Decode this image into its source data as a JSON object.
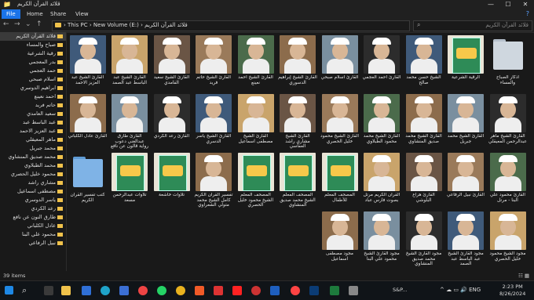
{
  "window": {
    "title": "قلائد القرآن الكريم",
    "controls": [
      "—",
      "☐",
      "✕"
    ]
  },
  "ribbon": {
    "tabs": [
      "File",
      "Home",
      "Share",
      "View"
    ],
    "help": "?"
  },
  "address": {
    "crumbs": "›  This PC  ›  New Volume (E:)  ›  قلائد القرآن الكريم",
    "search_placeholder": "قلائد القرآن الكريم"
  },
  "sidebar": {
    "items": [
      "قلائد القرآن الكريم",
      "صباح والمساء",
      "رقية الشرعية",
      "بدر المعجمي",
      "حمد العجمي",
      "اسلام صبحي",
      "ابراهيم الدوسري",
      "احمد نعينع",
      "حاتم فريد",
      "سعيد العامدي",
      "عبد الباسط عبد",
      "عبد العزيز الاحمد",
      "ماهر المعيقلي",
      "محمد جبريل",
      "محمد صديق المنشاوي",
      "محمد الطبلاوي",
      "محمود خليل الحصري",
      "مشاري راشد",
      "مصطفى اسماعيل",
      "ياسر الدوسري",
      "رعد الكردي",
      "طارق النون عن نافع",
      "عادل الكلباني",
      "محمود علي البنا",
      "نبيل الرفاعي"
    ]
  },
  "files": [
    {
      "label": "اذكار الصباح والمساء",
      "kind": "folder"
    },
    {
      "label": "الرقية الشرعية",
      "kind": "book"
    },
    {
      "label": "الشيخ حسن محمد صالح",
      "kind": "person"
    },
    {
      "label": "القارئ أحمد العجمي",
      "kind": "person"
    },
    {
      "label": "القارئ اسلام صبحي",
      "kind": "person"
    },
    {
      "label": "القارئ الشيخ إبراهيم الدسوري",
      "kind": "person"
    },
    {
      "label": "القارئ الشيخ أحمد نعينع",
      "kind": "person"
    },
    {
      "label": "القارئ الشيخ حاتم فريد",
      "kind": "person"
    },
    {
      "label": "القارئ الشيخ سعيد القامدي",
      "kind": "person"
    },
    {
      "label": "القارئ الشيخ عبد الباسط عبد الصمد",
      "kind": "person"
    },
    {
      "label": "القارئ الشيخ عبد العزيز الاحمد",
      "kind": "person"
    },
    {
      "label": "القارئ الشيخ ماهر عبدالرحمن المعيقلي",
      "kind": "person"
    },
    {
      "label": "القارئ الشيخ محمد جبريل",
      "kind": "person"
    },
    {
      "label": "القارئ الشيخ محمد صديق المنشاوي",
      "kind": "person"
    },
    {
      "label": "القارئ الشيخ محمد محمود الطبلاوي",
      "kind": "person"
    },
    {
      "label": "القارئ الشيخ محمود خليل الحصري",
      "kind": "person"
    },
    {
      "label": "القارئ الشيخ مشاري راشد العفاسي",
      "kind": "person"
    },
    {
      "label": "القارئ الشيخ مصطفى اسماعيل",
      "kind": "person"
    },
    {
      "label": "القارئ الشيخ ياسر الدسري",
      "kind": "person"
    },
    {
      "label": "القارئ رعد الكردي",
      "kind": "person"
    },
    {
      "label": "القارئ طارق عبدالغني دعوب رواية قالون عن نافع",
      "kind": "person"
    },
    {
      "label": "القارئ عادل الكلباني",
      "kind": "person"
    },
    {
      "label": "القارئ محمود علي البنا - مرتل",
      "kind": "person"
    },
    {
      "label": "القارئ نبيل الرفاعي",
      "kind": "person"
    },
    {
      "label": "القارئ هزاع البلوشي",
      "kind": "person"
    },
    {
      "label": "القرآن الكريم مرتل بصوت فارس عباد",
      "kind": "person"
    },
    {
      "label": "المصحف المعلم للأطفال",
      "kind": "book"
    },
    {
      "label": "المصحف المعلم الشيخ محمد صديق المنشاوي",
      "kind": "book"
    },
    {
      "label": "المصحف المعلم الشيخ محمود خليل الحصري",
      "kind": "book"
    },
    {
      "label": "تفسير القرآن الكريم كامل الشيخ محمد متولي الشعراوي",
      "kind": "person"
    },
    {
      "label": "تلاوات خاشعة",
      "kind": "book"
    },
    {
      "label": "تلاوات عبدالرحمن مسعد",
      "kind": "book"
    },
    {
      "label": "كتب تفسير القرآن الكريم",
      "kind": "folder-blue"
    },
    {
      "label": "مجود الشيخ محمود خليل الحصري",
      "kind": "person"
    },
    {
      "label": "مجود القارئ الشيخ عبد الباسط عبد الصمد",
      "kind": "person"
    },
    {
      "label": "مجود القارئ الشيخ محمد صديق المنشاوي",
      "kind": "person"
    },
    {
      "label": "مجود القارئ الشيخ محمود علي البنا",
      "kind": "person"
    },
    {
      "label": "مجود مصطفى اسماعيل",
      "kind": "person"
    }
  ],
  "status": {
    "items": "39 items",
    "views": "☷ ▦"
  },
  "taskbar": {
    "stock": "S&P...",
    "tray": "^ ☁ ▭ 🔊 ENG",
    "time": "2:23 PM",
    "date": "8/26/2024"
  },
  "colors": {
    "accent": "#1a73e8",
    "folder": "#f0c24b",
    "background": "#191919"
  }
}
